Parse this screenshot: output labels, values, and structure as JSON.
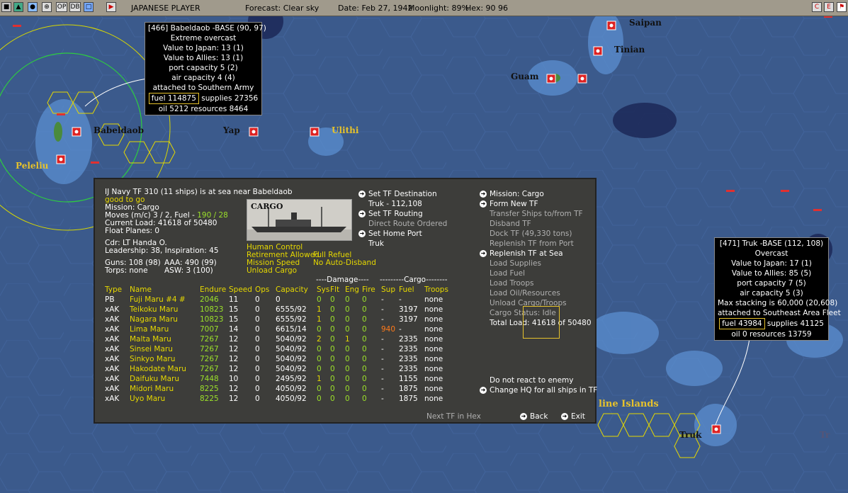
{
  "topbar": {
    "side": "JAPANESE PLAYER",
    "forecast": "Forecast: Clear sky",
    "date": "Date: Feb 27, 1942",
    "moonlight": "Moonlight: 89%",
    "hex": "Hex: 90 96",
    "btn_op": "OP",
    "btn_db": "DB",
    "btn_c": "C",
    "btn_e": "E"
  },
  "map_labels": {
    "babeldaob": "Babeldaob",
    "peleliu": "Peleliu",
    "yap": "Yap",
    "ulithi": "Ulithi",
    "guam": "Guam",
    "saipan": "Saipan",
    "tinian": "Tinian",
    "truk": "Truk",
    "caroline": "line Islands",
    "tr": "Tr",
    "tf": "TF"
  },
  "base_babeldaob": {
    "lines": [
      "[466] Babeldaob -BASE (90, 97)",
      "Extreme overcast",
      "Value to Japan: 13 (1)",
      "Value to Allies: 13 (1)",
      "port capacity 5 (2)",
      "air capacity 4 (4)",
      "attached to Southern Army"
    ],
    "fuel": "fuel 114875",
    "supplies": "supplies 27356",
    "last": "oil 5212  resources 8464"
  },
  "base_truk": {
    "lines": [
      "[471] Truk -BASE (112, 108)",
      "Overcast",
      "Value to Japan: 17 (1)",
      "Value to Allies: 85 (5)",
      "port capacity 7 (5)",
      "air capacity 5 (3)",
      "Max stacking is 60,000 (20,608)",
      "attached to Southeast Area Fleet"
    ],
    "fuel": "fuel 43984",
    "supplies": "supplies 41125",
    "last": "oil 0 resources 13759"
  },
  "tf": {
    "header": "IJ Navy TF 310 (11 ships) is at sea near Babeldaob",
    "status": "good to go",
    "mission": "Mission: Cargo",
    "moves_label": "Moves (m/c) 3 / 2, Fuel - ",
    "moves_value": "190 / 28",
    "load": "Current Load: 41618 of 50480",
    "float": "Float Planes: 0",
    "cdr": "Cdr: LT Handa O.",
    "leadership": "Leadership: 38, Inspiration: 45",
    "guns": "Guns: 108 (98)",
    "aaa": "AAA: 490 (99)",
    "torps": "Torps: none",
    "asw": "ASW: 3 (100)",
    "cargo_caption": "CARGO",
    "opts": [
      "Human Control",
      "Retirement Allowed",
      "Mission Speed",
      "Unload Cargo",
      "Full Refuel",
      "No Auto-Disband"
    ],
    "mid_menu": [
      {
        "label": "Set TF Destination",
        "arrow": true,
        "style": "w"
      },
      {
        "label": "Truk - 112,108",
        "arrow": false,
        "style": "w"
      },
      {
        "label": "Set TF Routing",
        "arrow": true,
        "style": "w"
      },
      {
        "label": "Direct Route Ordered",
        "arrow": false,
        "style": "gr"
      },
      {
        "label": "Set Home Port",
        "arrow": true,
        "style": "w"
      },
      {
        "label": "Truk",
        "arrow": false,
        "style": "w"
      }
    ],
    "right_menu": [
      {
        "label": "Mission: Cargo",
        "arrow": true,
        "style": "w"
      },
      {
        "label": "Form New TF",
        "arrow": true,
        "style": "w"
      },
      {
        "label": "Transfer Ships to/from TF",
        "arrow": false,
        "style": "gr"
      },
      {
        "label": "Disband TF",
        "arrow": false,
        "style": "gr"
      },
      {
        "label": "Dock TF (49,330 tons)",
        "arrow": false,
        "style": "gr"
      },
      {
        "label": "Replenish TF from Port",
        "arrow": false,
        "style": "gr"
      },
      {
        "label": "Replenish TF at Sea",
        "arrow": true,
        "style": "w"
      },
      {
        "label": "Load Supplies",
        "arrow": false,
        "style": "gr"
      },
      {
        "label": "Load Fuel",
        "arrow": false,
        "style": "gr"
      },
      {
        "label": "Load Troops",
        "arrow": false,
        "style": "gr"
      },
      {
        "label": "Load Oil/Resources",
        "arrow": false,
        "style": "gr"
      },
      {
        "label": "Unload Cargo/Troops",
        "arrow": false,
        "style": "gr"
      },
      {
        "label": "Cargo Status: Idle",
        "arrow": false,
        "style": "gr"
      },
      {
        "label": "Total Load: 41618 of 50480",
        "arrow": false,
        "style": "w"
      }
    ],
    "react": "Do not react to enemy",
    "change_hq": "Change HQ for all ships in TF",
    "next_tf": "Next TF in Hex",
    "back": "Back",
    "exit": "Exit",
    "damage_group": "----Damage----",
    "cargo_group": "---------Cargo--------",
    "columns": [
      "Type",
      "Name",
      "Endure",
      "Speed",
      "Ops",
      "Capacity",
      "Sys",
      "Flt",
      "Eng",
      "Fire",
      "Sup",
      "Fuel",
      "Troops"
    ],
    "ships": [
      [
        "PB",
        "Fuji Maru #4 #",
        "2046",
        "11",
        "0",
        "0",
        "0",
        "0",
        "0",
        "0",
        "-",
        "-",
        "none"
      ],
      [
        "xAK",
        "Teikoku Maru",
        "10823",
        "15",
        "0",
        "6555/92",
        "1",
        "0",
        "0",
        "0",
        "-",
        "3197",
        "none"
      ],
      [
        "xAK",
        "Nagara Maru",
        "10823",
        "15",
        "0",
        "6555/92",
        "1",
        "0",
        "0",
        "0",
        "-",
        "3197",
        "none"
      ],
      [
        "xAK",
        "Lima Maru",
        "7007",
        "14",
        "0",
        "6615/14",
        "0",
        "0",
        "0",
        "0",
        "940",
        "-",
        "none"
      ],
      [
        "xAK",
        "Malta Maru",
        "7267",
        "12",
        "0",
        "5040/92",
        "2",
        "0",
        "1",
        "0",
        "-",
        "2335",
        "none"
      ],
      [
        "xAK",
        "Sinsei Maru",
        "7267",
        "12",
        "0",
        "5040/92",
        "0",
        "0",
        "0",
        "0",
        "-",
        "2335",
        "none"
      ],
      [
        "xAK",
        "Sinkyo Maru",
        "7267",
        "12",
        "0",
        "5040/92",
        "0",
        "0",
        "0",
        "0",
        "-",
        "2335",
        "none"
      ],
      [
        "xAK",
        "Hakodate Maru",
        "7267",
        "12",
        "0",
        "5040/92",
        "0",
        "0",
        "0",
        "0",
        "-",
        "2335",
        "none"
      ],
      [
        "xAK",
        "Daifuku Maru",
        "7448",
        "10",
        "0",
        "2495/92",
        "1",
        "0",
        "0",
        "0",
        "-",
        "1155",
        "none"
      ],
      [
        "xAK",
        "Midori Maru",
        "8225",
        "12",
        "0",
        "4050/92",
        "0",
        "0",
        "0",
        "0",
        "-",
        "1875",
        "none"
      ],
      [
        "xAK",
        "Uyo Maru",
        "8225",
        "12",
        "0",
        "4050/92",
        "0",
        "0",
        "0",
        "0",
        "-",
        "1875",
        "none"
      ]
    ]
  }
}
